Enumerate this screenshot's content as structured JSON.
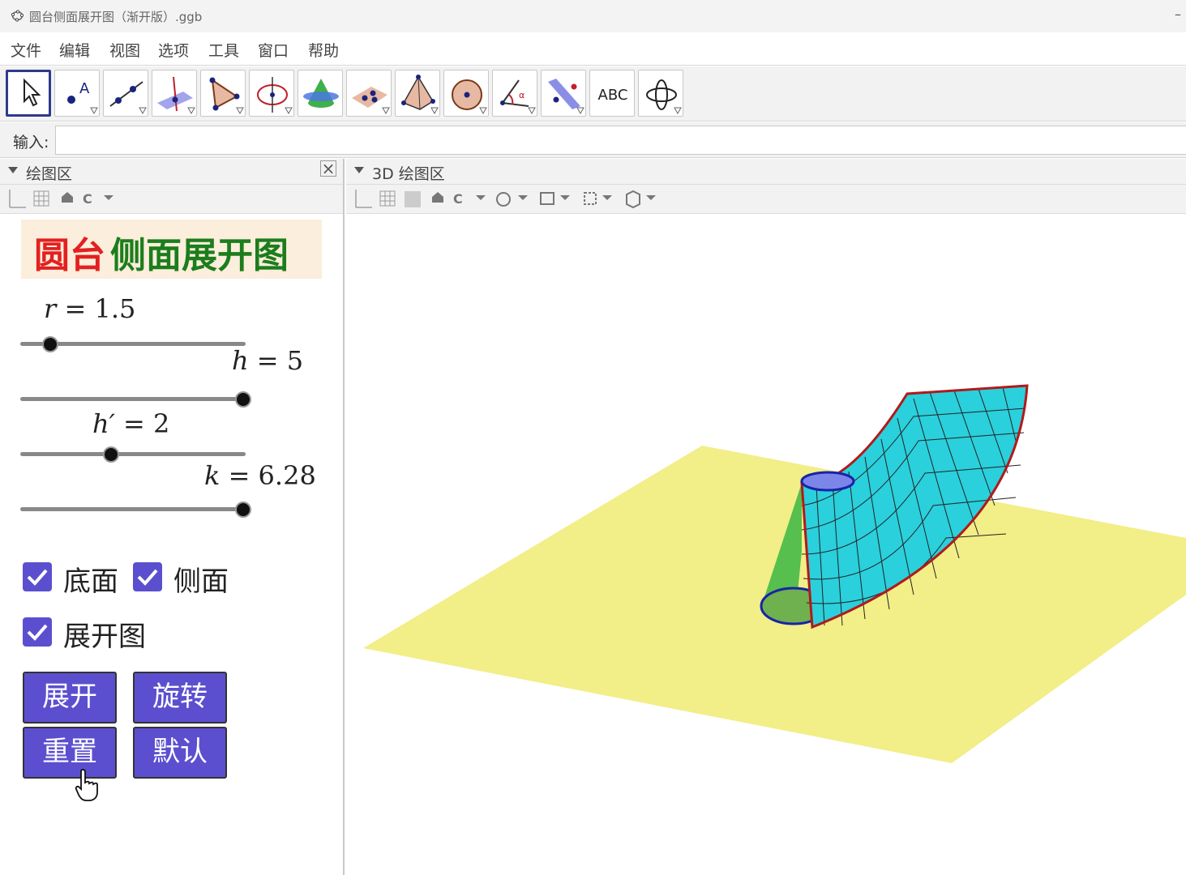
{
  "window": {
    "title": "圆台侧面展开图（渐开版）.ggb",
    "minimize": "–"
  },
  "menu": [
    "文件",
    "编辑",
    "视图",
    "选项",
    "工具",
    "窗口",
    "帮助"
  ],
  "toolbar": {
    "tools": [
      "move-tool",
      "point-tool",
      "line-tool",
      "perpendicular-tool",
      "polygon-tool",
      "circle-axis-tool",
      "intersect-surfaces-tool",
      "plane-tool",
      "pyramid-tool",
      "sphere-tool",
      "angle-tool",
      "reflect-tool",
      "text-tool",
      "rotate-view-tool"
    ],
    "text_tool_label": "ABC"
  },
  "input": {
    "label": "输入:",
    "value": ""
  },
  "left_panel": {
    "title": "绘图区",
    "heading_red": "圆台",
    "heading_green": "侧面展开图",
    "sliders": [
      {
        "var": "r",
        "value": "1.5",
        "fraction": 0.13
      },
      {
        "var": "h",
        "value": "5",
        "fraction": 1.0
      },
      {
        "var": "h′",
        "value": "2",
        "fraction": 0.4
      },
      {
        "var": "k",
        "value": "6.28",
        "fraction": 1.0
      }
    ],
    "checkboxes": [
      {
        "label": "底面",
        "checked": true
      },
      {
        "label": "侧面",
        "checked": true
      },
      {
        "label": "展开图",
        "checked": true
      }
    ],
    "buttons": {
      "expand": "展开",
      "rotate": "旋转",
      "reset": "重置",
      "default": "默认"
    }
  },
  "right_panel": {
    "title": "3D 绘图区"
  },
  "colors": {
    "button": "#5b4fcf",
    "plane": "#f2ee88",
    "surface": "#2ad0dc",
    "outline": "#b01a1a",
    "heading_red": "#e32020",
    "heading_green": "#1c7d1c"
  }
}
